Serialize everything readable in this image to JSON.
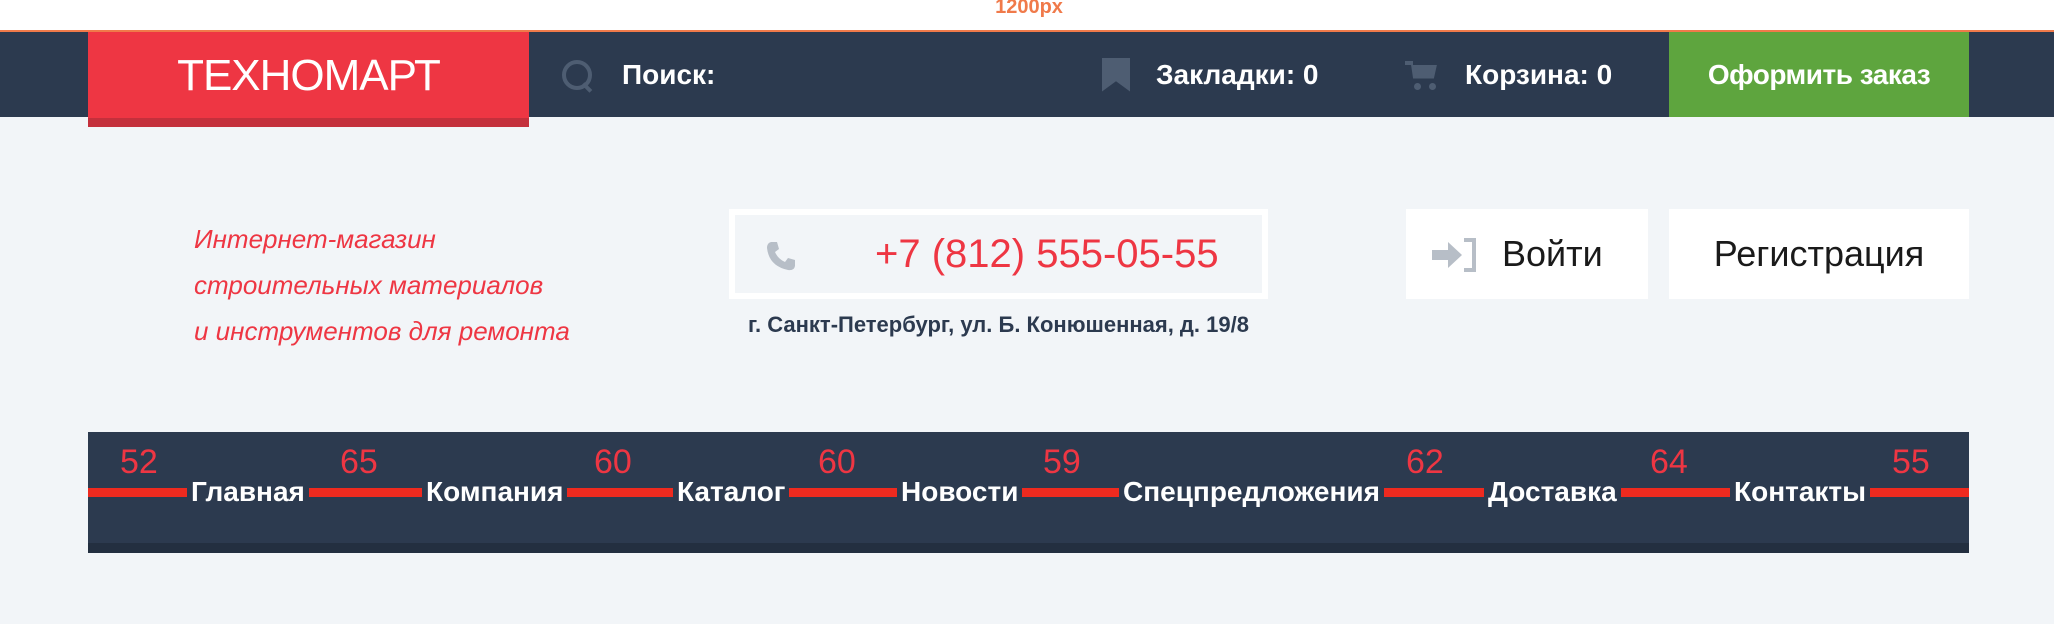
{
  "ruler": {
    "label": "1200px"
  },
  "header": {
    "logo": "ТЕХНОМАРТ",
    "search_label": "Поиск:",
    "bookmarks_label": "Закладки: 0",
    "cart_label": "Корзина: 0",
    "order_button": "Оформить заказ"
  },
  "info": {
    "tagline": [
      "Интернет-магазин",
      "строительных материалов",
      "и инструментов для ремонта"
    ],
    "phone": "+7 (812) 555-05-55",
    "address": "г. Санкт-Петербург, ул. Б. Конюшенная, д. 19/8",
    "login_button": "Войти",
    "register_button": "Регистрация"
  },
  "nav": {
    "items": [
      "Главная",
      "Компания",
      "Каталог",
      "Новости",
      "Спецпредложения",
      "Доставка",
      "Контакты"
    ],
    "gap_labels": [
      "52",
      "65",
      "60",
      "60",
      "59",
      "62",
      "64",
      "55"
    ]
  },
  "colors": {
    "accent_red": "#ee3643",
    "dark_bar": "#2c3a4f",
    "order_green": "#5ea53e",
    "ruler_orange": "#f07a4a"
  }
}
